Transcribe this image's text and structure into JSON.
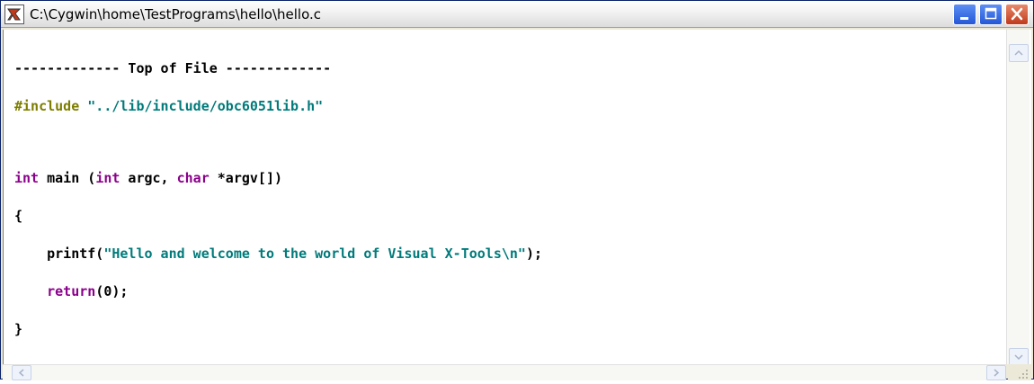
{
  "window": {
    "title": "C:\\Cygwin\\home\\TestPrograms\\hello\\hello.c"
  },
  "titlebar_buttons": {
    "minimize_icon": "minimize-icon",
    "maximize_icon": "maximize-icon",
    "close_icon": "close-icon"
  },
  "editor": {
    "lines": {
      "l0": "------------- Top of File -------------",
      "l1_directive": "#include",
      "l1_path": " \"../lib/include/obc6051lib.h\"",
      "l2_int": "int",
      "l2_main": " main (",
      "l2_int2": "int",
      "l2_argc": " argc, ",
      "l2_char": "char",
      "l2_argv": " *argv[])",
      "l3": "{",
      "l4_indent": "    ",
      "l4_printf": "printf(",
      "l4_string": "\"Hello and welcome to the world of Visual X-Tools\\n\"",
      "l4_end": ");",
      "l5_indent": "    ",
      "l5_return": "return",
      "l5_end": "(0);",
      "l6": "}"
    }
  },
  "colors": {
    "include_directive": "#7d7d00",
    "string": "#007a7a",
    "keyword": "#8b008b",
    "titlebar_close": "#c0391b",
    "titlebar_button": "#2557d6"
  },
  "icons": {
    "app": "xtools-app-icon",
    "scroll_up": "chevron-up-icon",
    "scroll_down": "chevron-down-icon",
    "scroll_left": "chevron-left-icon",
    "scroll_right": "chevron-right-icon",
    "resize": "resize-grip-icon"
  }
}
